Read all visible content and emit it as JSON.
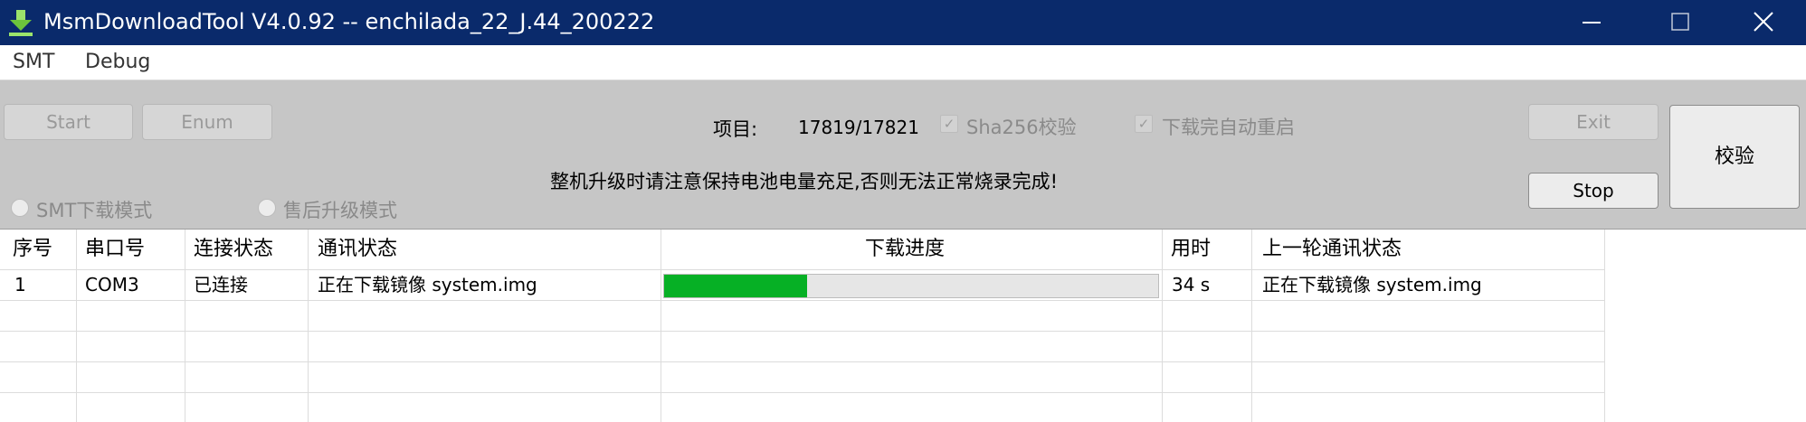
{
  "window": {
    "title": "MsmDownloadTool V4.0.92 -- enchilada_22_J.44_200222",
    "title_bar_color": "#0a2a6b"
  },
  "menu": {
    "items": [
      "SMT",
      "Debug"
    ]
  },
  "toolbar": {
    "start_label": "Start",
    "enum_label": "Enum",
    "exit_label": "Exit",
    "stop_label": "Stop",
    "verify_label": "校验",
    "items_label": "项目:",
    "items_value": "17819/17821",
    "sha256_label": "Sha256校验",
    "auto_reboot_label": "下载完自动重启",
    "notice": "整机升级时请注意保持电池电量充足,否则无法正常烧录完成!",
    "mode_smt_label": "SMT下载模式",
    "mode_aftersales_label": "售后升级模式"
  },
  "table": {
    "headers": [
      "序号",
      "串口号",
      "连接状态",
      "通讯状态",
      "下载进度",
      "用时",
      "上一轮通讯状态"
    ],
    "rows": [
      {
        "index": "1",
        "port": "COM3",
        "connection": "已连接",
        "status": "正在下载镜像 system.img",
        "progress": 0.29,
        "time": "34 s",
        "last_status": "正在下载镜像 system.img"
      }
    ]
  },
  "colors": {
    "progress": "#06b025",
    "panel": "#c6c6c6"
  },
  "icons": {
    "app": "download-arrow-icon",
    "minimize": "minimize-icon",
    "maximize": "maximize-icon",
    "close": "close-icon"
  }
}
